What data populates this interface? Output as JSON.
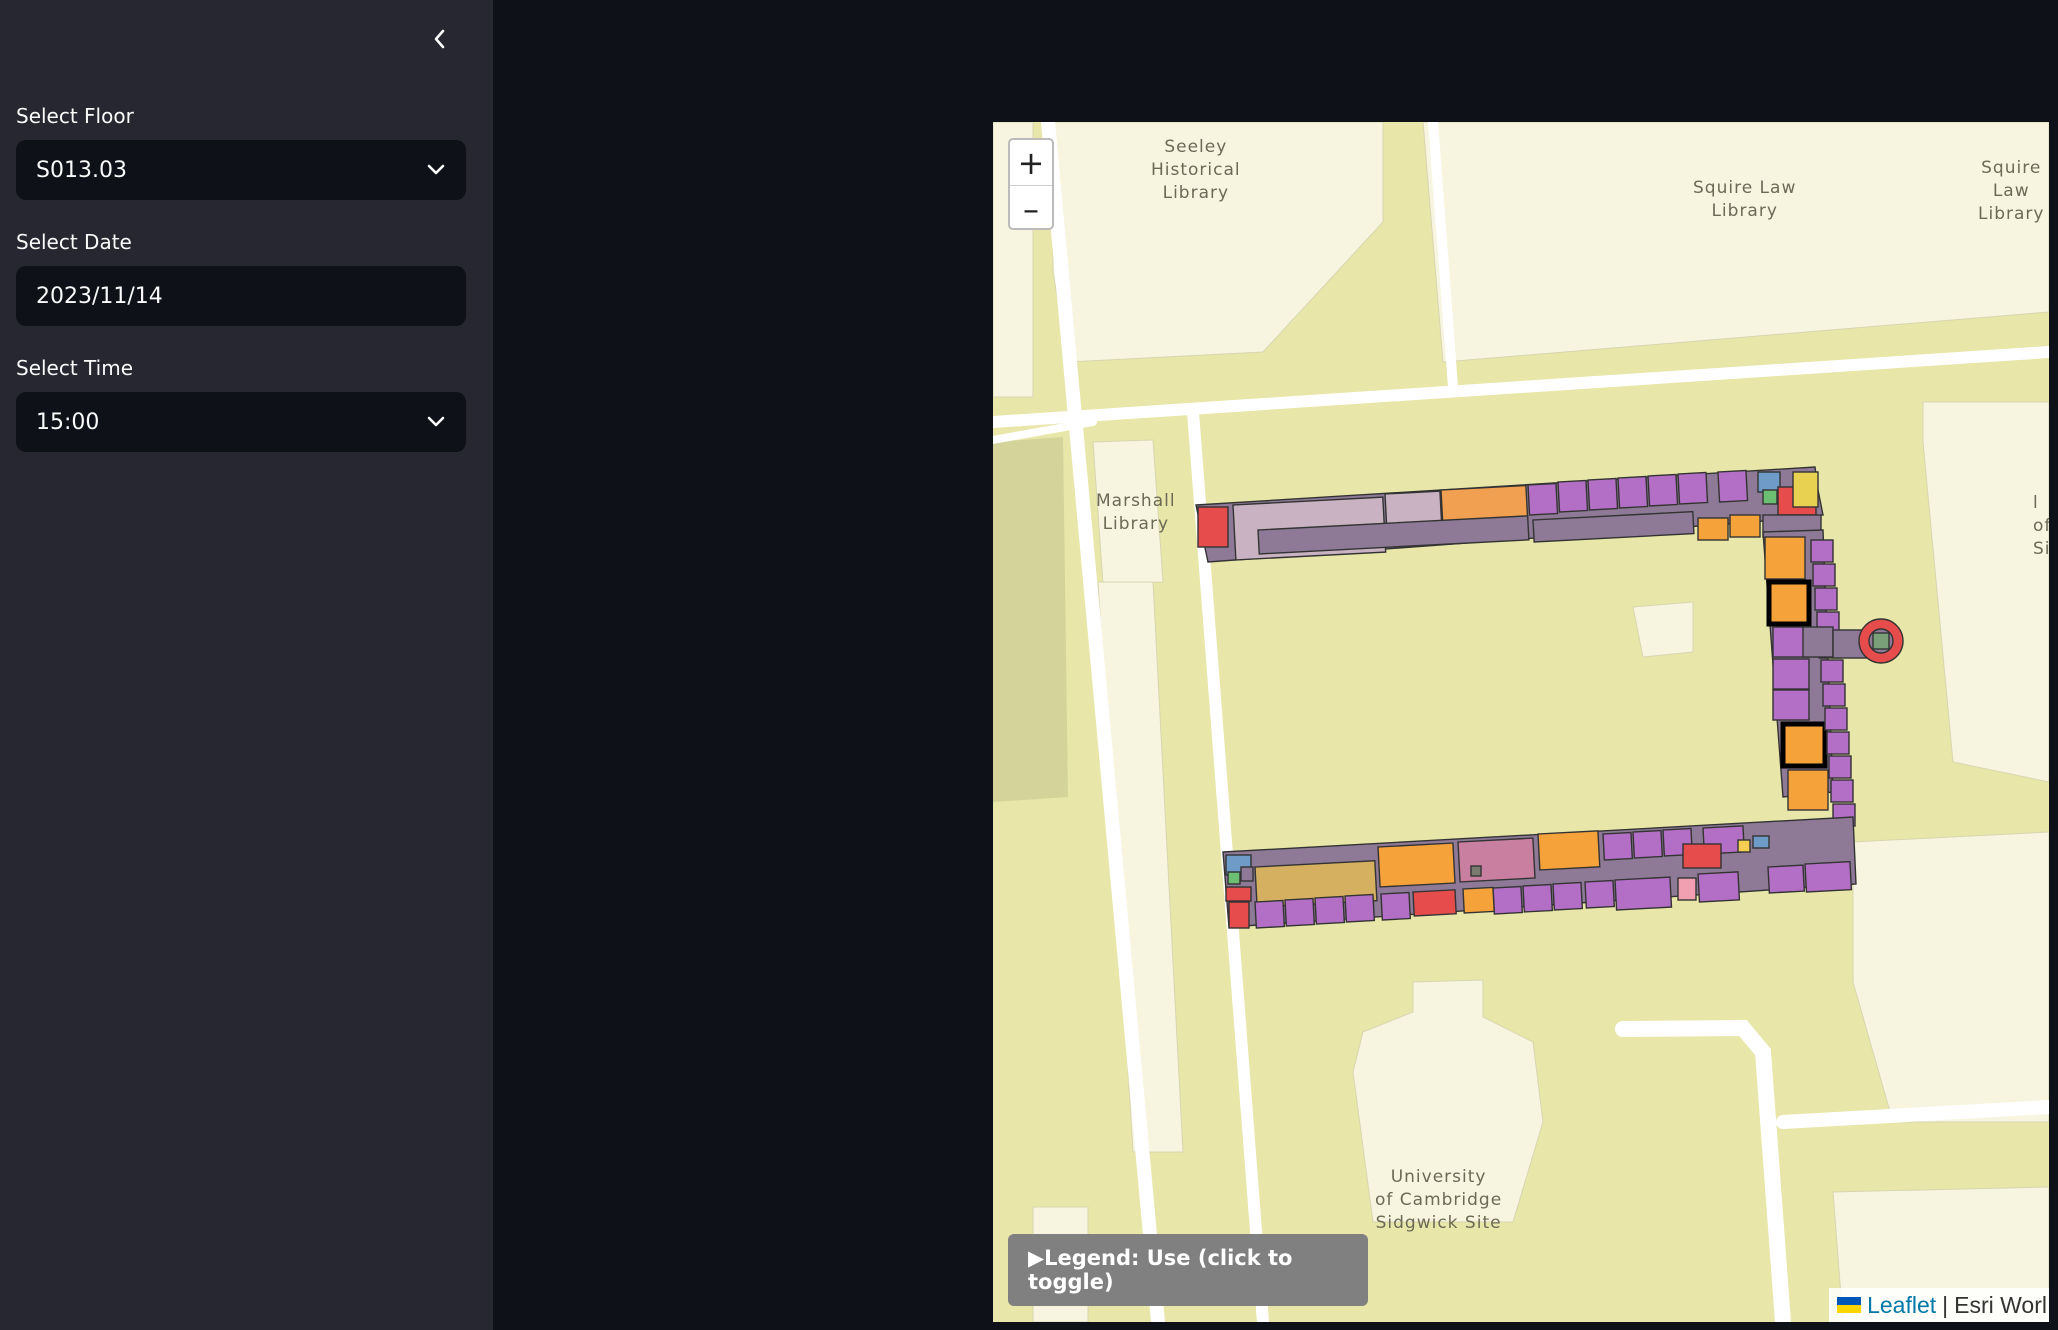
{
  "sidebar": {
    "collapse_icon": "chevron-left-icon",
    "floor": {
      "label": "Select Floor",
      "value": "S013.03"
    },
    "date": {
      "label": "Select Date",
      "value": "2023/11/14"
    },
    "time": {
      "label": "Select Time",
      "value": "15:00"
    }
  },
  "map": {
    "zoom_in": "+",
    "zoom_out": "–",
    "labels": {
      "seeley": "Seeley\nHistorical\nLibrary",
      "squire_law_1": "Squire Law\nLibrary",
      "squire_law_2": "Squire\nLaw\nLibrary",
      "marshall": "Marshall\nLibrary",
      "cambridge": "University\nof Cambridge\nSidgwick Site",
      "partial_right": "l\nof\nSi"
    },
    "legend_toggle": "▶Legend: Use (click to toggle)",
    "attribution": {
      "link": "Leaflet",
      "separator": "|",
      "text": "Esri Worl"
    },
    "colors": {
      "land": "#e8e6a8",
      "building": "#f7f5e0",
      "road": "#ffffff",
      "use_purple": "#b36fc6",
      "use_orange": "#f5a23a",
      "use_red": "#e74c4c",
      "use_mauve": "#b9a0b0",
      "use_blue": "#6f9bc8",
      "use_green": "#6cbf72"
    }
  }
}
